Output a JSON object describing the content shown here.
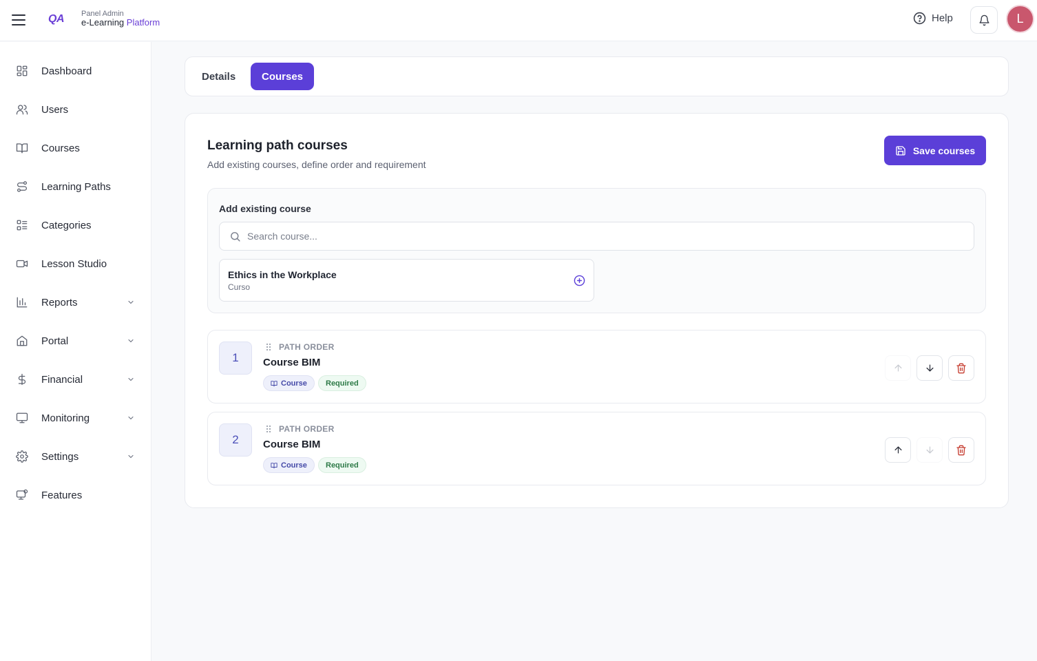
{
  "header": {
    "logo": "QA",
    "brand_sub": "Panel Admin",
    "brand_main_prefix": "e-Learning",
    "brand_main_accent": "Platform",
    "help_label": "Help",
    "avatar_initial": "L",
    "accent_color": "#5b3fd8",
    "avatar_color": "#c9576d"
  },
  "sidebar": {
    "items": [
      {
        "label": "Dashboard",
        "icon": "dashboard-icon",
        "expandable": false
      },
      {
        "label": "Users",
        "icon": "users-icon",
        "expandable": false
      },
      {
        "label": "Courses",
        "icon": "book-icon",
        "expandable": false
      },
      {
        "label": "Learning Paths",
        "icon": "route-icon",
        "expandable": false
      },
      {
        "label": "Categories",
        "icon": "list-icon",
        "expandable": false
      },
      {
        "label": "Lesson Studio",
        "icon": "video-icon",
        "expandable": false
      },
      {
        "label": "Reports",
        "icon": "chart-icon",
        "expandable": true
      },
      {
        "label": "Portal",
        "icon": "building-icon",
        "expandable": true
      },
      {
        "label": "Financial",
        "icon": "dollar-icon",
        "expandable": true
      },
      {
        "label": "Monitoring",
        "icon": "monitor-icon",
        "expandable": true
      },
      {
        "label": "Settings",
        "icon": "gear-icon",
        "expandable": true
      },
      {
        "label": "Features",
        "icon": "features-icon",
        "expandable": false
      }
    ]
  },
  "tabs": [
    {
      "label": "Details",
      "active": false
    },
    {
      "label": "Courses",
      "active": true
    }
  ],
  "main": {
    "title": "Learning path courses",
    "subtitle": "Add existing courses, define order and requirement",
    "save_label": "Save courses",
    "add_section": {
      "title": "Add existing course",
      "search_placeholder": "Search course...",
      "search_value": "",
      "results": [
        {
          "title": "Ethics in the Workplace",
          "subtitle": "Curso"
        }
      ]
    },
    "path_courses": [
      {
        "order": "1",
        "order_label": "PATH ORDER",
        "name": "Course BIM",
        "type_badge": "Course",
        "req_badge": "Required",
        "up_enabled": false,
        "down_enabled": true
      },
      {
        "order": "2",
        "order_label": "PATH ORDER",
        "name": "Course BIM",
        "type_badge": "Course",
        "req_badge": "Required",
        "up_enabled": true,
        "down_enabled": false
      }
    ]
  }
}
